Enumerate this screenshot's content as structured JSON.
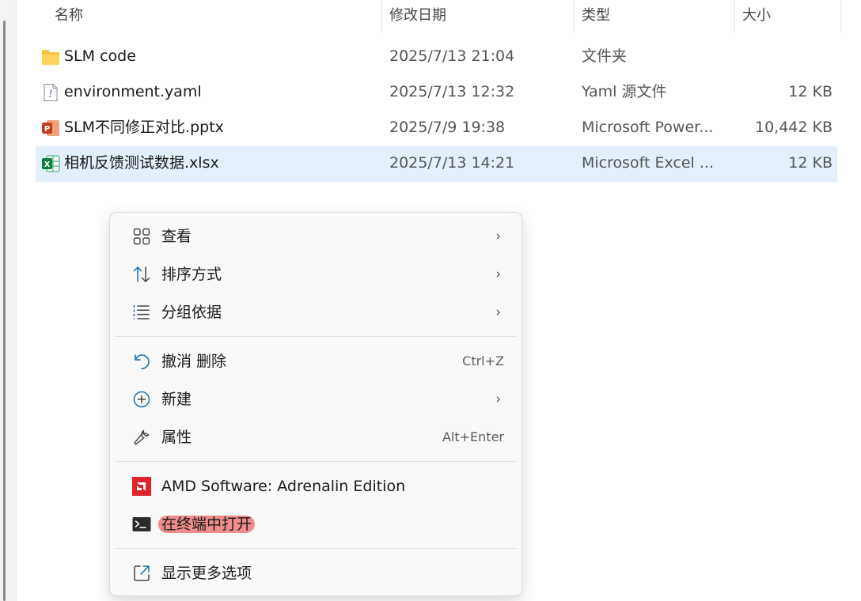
{
  "columns": {
    "name": "名称",
    "date": "修改日期",
    "type": "类型",
    "size": "大小"
  },
  "files": [
    {
      "icon": "folder-icon",
      "name": "SLM code",
      "date": "2025/7/13 21:04",
      "type": "文件夹",
      "size": ""
    },
    {
      "icon": "yaml-file-icon",
      "name": "environment.yaml",
      "date": "2025/7/13 12:32",
      "type": "Yaml 源文件",
      "size": "12 KB"
    },
    {
      "icon": "powerpoint-file-icon",
      "name": "SLM不同修正对比.pptx",
      "date": "2025/7/9 19:38",
      "type": "Microsoft Power...",
      "size": "10,442 KB"
    },
    {
      "icon": "excel-file-icon",
      "name": "相机反馈测试数据.xlsx",
      "date": "2025/7/13 14:21",
      "type": "Microsoft Excel ...",
      "size": "12 KB",
      "selected": true
    }
  ],
  "context_menu": {
    "view": "查看",
    "sort": "排序方式",
    "group": "分组依据",
    "undo": "撤消 删除",
    "undo_shortcut": "Ctrl+Z",
    "new": "新建",
    "properties": "属性",
    "properties_shortcut": "Alt+Enter",
    "amd": "AMD Software: Adrenalin Edition",
    "terminal": "在终端中打开",
    "more": "显示更多选项",
    "submenu_arrow": "›"
  },
  "colors": {
    "selection": "#e3f0fb",
    "highlight": "#f08c8c",
    "amd_red": "#e0242c",
    "accent_blue": "#1f6fb5"
  }
}
